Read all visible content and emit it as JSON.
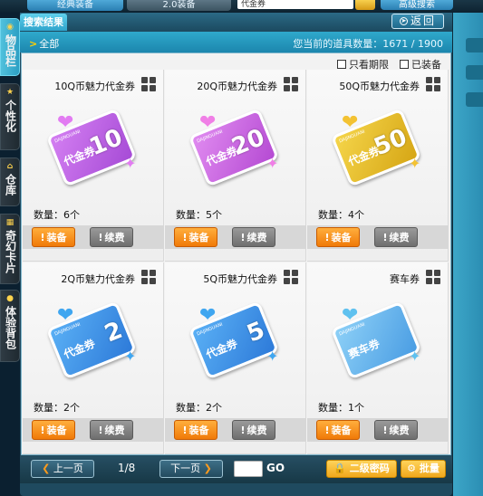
{
  "top": {
    "tab1": "经典装备",
    "tab2": "2.0装备",
    "search_value": "代金券",
    "advanced": "高级搜索"
  },
  "nav": [
    {
      "label": "物品栏",
      "icon": "bag-icon"
    },
    {
      "label": "个性化",
      "icon": "star-icon"
    },
    {
      "label": "仓库",
      "icon": "house-icon"
    },
    {
      "label": "奇幻卡片",
      "icon": "card-icon"
    },
    {
      "label": "体验背包",
      "icon": "lock-icon"
    }
  ],
  "header": {
    "search_tab": "搜索结果",
    "back": "返回"
  },
  "filter": {
    "all": "全部",
    "count_label": "您当前的道具数量：1671 / 1900"
  },
  "checks": {
    "expiry_only": "只看期限",
    "equipped": "已装备"
  },
  "items": [
    {
      "name": "10Q币魅力代金券",
      "qty": "数量：6个",
      "num": "10",
      "label": "代金券",
      "color": "#a64bd6",
      "color2": "#d47ff2",
      "heart": "#e27cf2",
      "equip": "装备",
      "renew": "续费"
    },
    {
      "name": "20Q币魅力代金券",
      "qty": "数量：5个",
      "num": "20",
      "label": "代金券",
      "color": "#b54ad3",
      "color2": "#e08bf0",
      "heart": "#f07fe6",
      "equip": "装备",
      "renew": "续费"
    },
    {
      "name": "50Q币魅力代金券",
      "qty": "数量：4个",
      "num": "50",
      "label": "代金券",
      "color": "#d6a615",
      "color2": "#f5d54a",
      "heart": "#f3c232",
      "equip": "装备",
      "renew": "续费"
    },
    {
      "name": "2Q币魅力代金券",
      "qty": "数量：2个",
      "num": "2",
      "label": "代金券",
      "color": "#2d7ad9",
      "color2": "#5ab0f5",
      "heart": "#3fa6f0",
      "equip": "装备",
      "renew": "续费"
    },
    {
      "name": "5Q币魅力代金券",
      "qty": "数量：2个",
      "num": "5",
      "label": "代金券",
      "color": "#2d7ad9",
      "color2": "#5ab0f5",
      "heart": "#3fa6f0",
      "equip": "装备",
      "renew": "续费"
    },
    {
      "name": "赛车券",
      "qty": "数量：1个",
      "num": "",
      "label": "赛车券",
      "color": "#4a9de3",
      "color2": "#8dd0f7",
      "heart": "#5fc1ef",
      "equip": "装备",
      "renew": "续费"
    }
  ],
  "ticket_brand": "DAJINGUANI",
  "pager": {
    "prev": "上一页",
    "page": "1/8",
    "next": "下一页",
    "go": "GO",
    "password": "二级密码",
    "batch": "批量"
  }
}
